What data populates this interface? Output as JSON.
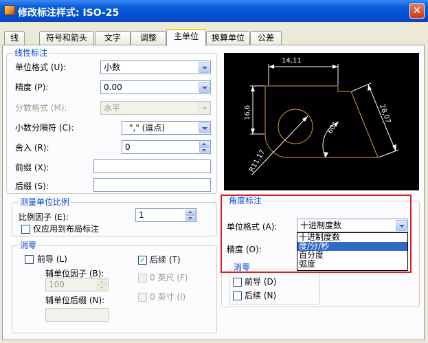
{
  "window": {
    "title": "修改标注样式: ISO-25",
    "close_glyph": "✕"
  },
  "tabs": [
    {
      "label": "线"
    },
    {
      "label": "符号和箭头"
    },
    {
      "label": "文字"
    },
    {
      "label": "调整"
    },
    {
      "label": "主单位",
      "active": true
    },
    {
      "label": "换算单位"
    },
    {
      "label": "公差"
    }
  ],
  "linear": {
    "legend": "线性标注",
    "unit_format": {
      "label": "单位格式 (U):",
      "value": "小数"
    },
    "precision": {
      "label": "精度 (P):",
      "value": "0.00"
    },
    "fraction_format": {
      "label": "分数格式 (M):",
      "value": "水平"
    },
    "decimal_separator": {
      "label": "小数分隔符 (C):",
      "value": "\",\"  (逗点)"
    },
    "round_off": {
      "label": "舍入 (R):",
      "value": "0"
    },
    "prefix": {
      "label": "前缀 (X):",
      "value": ""
    },
    "suffix": {
      "label": "后缀 (S):",
      "value": ""
    }
  },
  "scale": {
    "legend": "测量单位比例",
    "factor": {
      "label": "比例因子 (E):",
      "value": "1"
    },
    "layout_only": {
      "label": "仅应用到布局标注",
      "checked": false
    }
  },
  "zero_linear": {
    "legend": "消零",
    "leading": {
      "label": "前导 (L)",
      "checked": false
    },
    "trailing": {
      "label": "后续 (T)",
      "checked": true
    },
    "sub_factor": {
      "label": "辅单位因子 (B):",
      "value": "100"
    },
    "sub_suffix": {
      "label": "辅单位后缀 (N):",
      "value": ""
    },
    "feet": {
      "label": "0 英尺 (F)",
      "checked": false
    },
    "inches": {
      "label": "0 英寸 (I)",
      "checked": false
    }
  },
  "preview": {
    "labels": {
      "top": "14,11",
      "left": "16,6",
      "right": "28,07",
      "angle": "60°",
      "radius": "R11,17"
    },
    "colors": {
      "bg": "#000000",
      "line": "#ffffff",
      "geometry": "#d4a13a"
    }
  },
  "angular": {
    "legend": "角度标注",
    "unit_format": {
      "label": "单位格式 (A):",
      "value": "十进制度数"
    },
    "precision": {
      "label": "精度 (O):"
    },
    "options": [
      "十进制度数",
      "度/分/秒",
      "百分度",
      "弧度"
    ],
    "selected_option": "度/分/秒",
    "zero": {
      "legend": "消零",
      "leading": {
        "label": "前导 (D)",
        "checked": false
      },
      "trailing": {
        "label": "后续 (N)",
        "checked": false
      }
    },
    "highlight_color": "#d91f1f"
  }
}
